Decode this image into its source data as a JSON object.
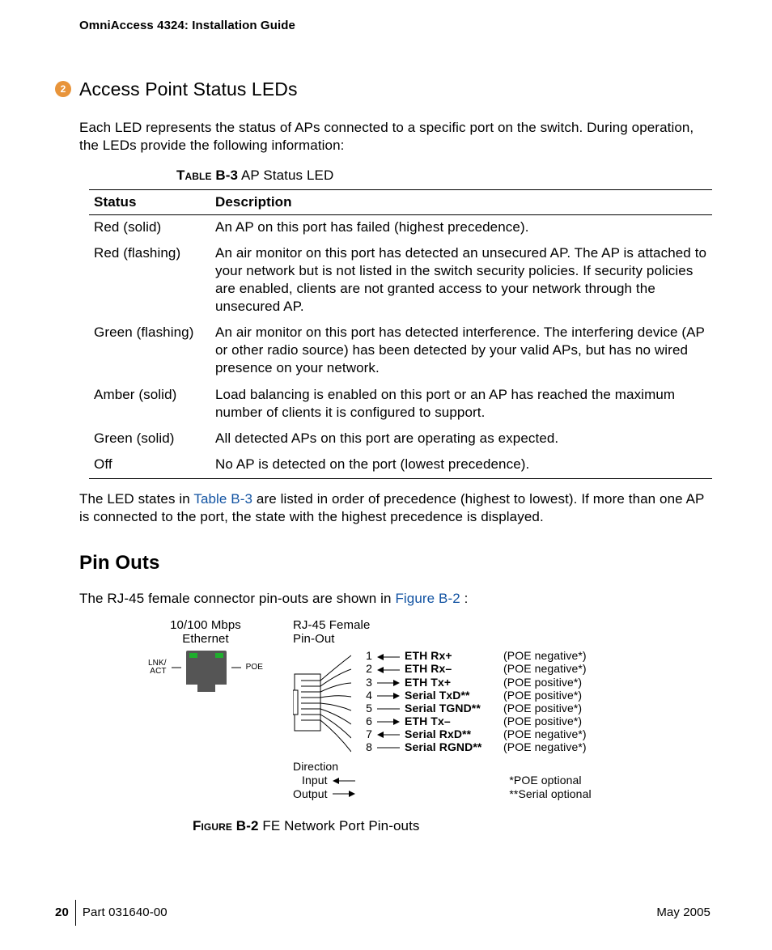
{
  "header": {
    "title": "OmniAccess 4324: Installation Guide"
  },
  "chapter_badge": "2",
  "section1": {
    "title": "Access Point Status LEDs",
    "intro": "Each LED represents the status of APs connected to a specific port on the switch. During operation, the LEDs provide the following information:"
  },
  "table": {
    "caption_bold": "Table B-3",
    "caption_rest": "  AP Status LED",
    "headers": {
      "status": "Status",
      "description": "Description"
    },
    "rows": [
      {
        "status": "Red (solid)",
        "description": "An AP on this port has failed (highest precedence)."
      },
      {
        "status": "Red (flashing)",
        "description": "An air monitor on this port has detected an unsecured AP. The AP is attached to your network but is not listed in the switch security policies. If security policies are enabled, clients are not granted access to your network through the unsecured AP."
      },
      {
        "status": "Green (flashing)",
        "description": "An air monitor on this port has detected interference. The interfering device (AP or other radio source) has been detected by your valid APs, but has no wired presence on your network."
      },
      {
        "status": "Amber (solid)",
        "description": "Load balancing is enabled on this port or an AP has reached the maximum number of clients it is configured to support."
      },
      {
        "status": "Green (solid)",
        "description": "All detected APs on this port are operating as expected."
      },
      {
        "status": "Off",
        "description": "No AP is detected on the port (lowest precedence)."
      }
    ]
  },
  "after_table": {
    "pre": "The LED states in ",
    "link": "Table B-3",
    "post": "  are listed in order of precedence (highest to lowest). If more than one AP is connected to the port, the state with the highest precedence is displayed."
  },
  "section2": {
    "title": "Pin Outs",
    "intro_pre": "The RJ-45 female connector pin-outs are shown in ",
    "intro_link": "Figure B-2",
    "intro_post": "  :"
  },
  "figure": {
    "eth_title_line1": "10/100 Mbps",
    "eth_title_line2": "Ethernet",
    "lnk_label": "LNK/\nACT",
    "poe_label": "POE",
    "pinout_title_line1": "RJ-45 Female",
    "pinout_title_line2": "Pin-Out",
    "pins": [
      {
        "n": "1",
        "dir": "in",
        "sig": "ETH Rx+",
        "poe": "(POE negative*)"
      },
      {
        "n": "2",
        "dir": "in",
        "sig": "ETH Rx–",
        "poe": "(POE negative*)"
      },
      {
        "n": "3",
        "dir": "out",
        "sig": "ETH Tx+",
        "poe": "(POE positive*)"
      },
      {
        "n": "4",
        "dir": "out",
        "sig": "Serial TxD**",
        "poe": "(POE positive*)"
      },
      {
        "n": "5",
        "dir": "none",
        "sig": "Serial TGND**",
        "poe": "(POE positive*)"
      },
      {
        "n": "6",
        "dir": "out",
        "sig": "ETH Tx–",
        "poe": "(POE positive*)"
      },
      {
        "n": "7",
        "dir": "in",
        "sig": "Serial RxD**",
        "poe": "(POE negative*)"
      },
      {
        "n": "8",
        "dir": "none",
        "sig": "Serial RGND**",
        "poe": "(POE negative*)"
      }
    ],
    "legend": {
      "direction_label": "Direction",
      "input_label": "Input",
      "output_label": "Output",
      "note1": "*POE optional",
      "note2": "**Serial optional"
    },
    "caption_bold": "Figure B-2",
    "caption_rest": "  FE Network Port Pin-outs"
  },
  "footer": {
    "page": "20",
    "part": "Part 031640-00",
    "date": "May 2005"
  }
}
